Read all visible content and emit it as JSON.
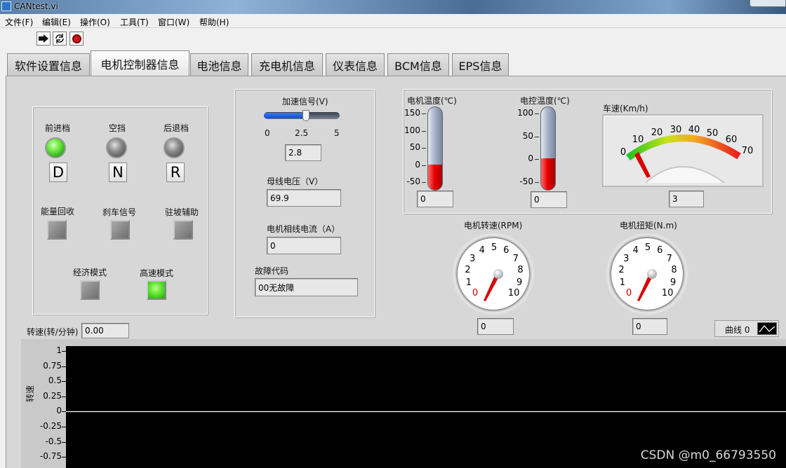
{
  "window": {
    "title": "CANtest.vi"
  },
  "menu": [
    "文件(F)",
    "编辑(E)",
    "操作(O)",
    "工具(T)",
    "窗口(W)",
    "帮助(H)"
  ],
  "toolbar": {
    "run_icon": "run-arrow-icon",
    "continuous_icon": "run-continuously-icon",
    "abort_icon": "abort-stop-icon"
  },
  "tabs": [
    "软件设置信息",
    "电机控制器信息",
    "电池信息",
    "充电机信息",
    "仪表信息",
    "BCM信息",
    "EPS信息"
  ],
  "active_tab": "电机控制器信息",
  "gear_panel": {
    "forward": {
      "label": "前进档",
      "letter": "D",
      "led": "on"
    },
    "neutral": {
      "label": "空挡",
      "letter": "N",
      "led": "off"
    },
    "reverse": {
      "label": "后退档",
      "letter": "R",
      "led": "off"
    },
    "regen_label": "能量回收",
    "brake_label": "刹车信号",
    "hill_hold_label": "驻坡辅助",
    "eco_label": "经济模式",
    "sport_label": "高速模式",
    "sport_led": "on"
  },
  "signals": {
    "accel_label": "加速信号(V)",
    "accel_ticks": [
      "0",
      "2.5",
      "5"
    ],
    "accel_min": 0,
    "accel_max": 5,
    "accel_value": 2.8,
    "accel_value_text": "2.8",
    "bus_voltage_label": "母线电压（V）",
    "bus_voltage_value": "69.9",
    "phase_current_label": "电机相线电流（A）",
    "phase_current_value": "0",
    "fault_label": "故障代码",
    "fault_value": "00无故障"
  },
  "motor_temp": {
    "label": "电机温度(℃)",
    "ticks": [
      "150",
      "100",
      "50",
      "0",
      "-50"
    ],
    "min": -50,
    "max": 150,
    "value": 0,
    "value_text": "0"
  },
  "ctrl_temp": {
    "label": "电控温度(℃)",
    "ticks": [
      "100",
      "50",
      "0",
      "-50"
    ],
    "min": -50,
    "max": 100,
    "value": 0,
    "value_text": "0"
  },
  "speed_gauge": {
    "label": "车速(Km/h)",
    "ticks": [
      "0",
      "10",
      "20",
      "30",
      "40",
      "50",
      "60",
      "70"
    ],
    "min": 0,
    "max": 70,
    "value": 3,
    "value_text": "3"
  },
  "motor_rpm_dial": {
    "label": "电机转速(RPM)",
    "ticks": [
      "0",
      "1",
      "2",
      "3",
      "4",
      "5",
      "6",
      "7",
      "8",
      "9",
      "10"
    ],
    "value": 0,
    "value_text": "0"
  },
  "motor_torque_dial": {
    "label": "电机扭矩(N.m)",
    "ticks": [
      "0",
      "1",
      "2",
      "3",
      "4",
      "5",
      "6",
      "7",
      "8",
      "9",
      "10"
    ],
    "value": 0,
    "value_text": "0"
  },
  "rpm_readout": {
    "label": "转速(转/分钟)",
    "value": "0.00"
  },
  "chart_legend": {
    "label": "曲线 0"
  },
  "chart_data": {
    "type": "line",
    "title": "",
    "xlabel": "",
    "ylabel": "转速",
    "yticks": [
      "1",
      "0.75",
      "0.5",
      "0.25",
      "0",
      "-0.25",
      "-0.5",
      "-0.75"
    ],
    "ylim": [
      -0.85,
      1
    ],
    "series": [
      {
        "name": "曲线 0",
        "x": [
          0,
          1
        ],
        "values": [
          0,
          0
        ]
      }
    ],
    "colors": {
      "background": "#000000",
      "line": "#ffffff"
    }
  },
  "watermark": "CSDN @m0_66793550"
}
